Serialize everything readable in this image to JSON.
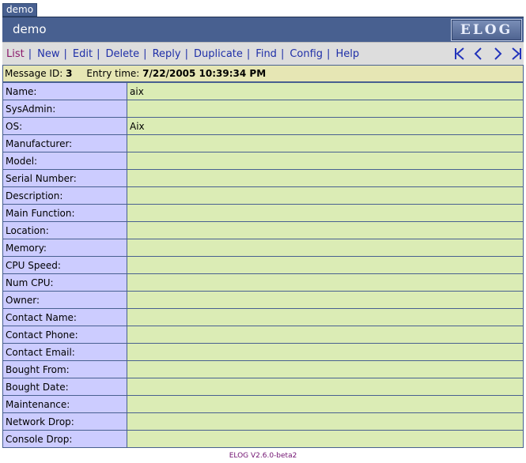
{
  "tab": {
    "label": "demo"
  },
  "header": {
    "title": "demo",
    "logo_text": "ELOG"
  },
  "menu": {
    "items": [
      {
        "label": "List",
        "active": true
      },
      {
        "label": "New"
      },
      {
        "label": "Edit"
      },
      {
        "label": "Delete"
      },
      {
        "label": "Reply"
      },
      {
        "label": "Duplicate"
      },
      {
        "label": "Find"
      },
      {
        "label": "Config"
      },
      {
        "label": "Help"
      }
    ],
    "separator": "|",
    "nav_icons": [
      "first-icon",
      "previous-icon",
      "next-icon",
      "last-icon"
    ]
  },
  "info": {
    "message_id_label": "Message ID:",
    "message_id": "3",
    "entry_time_label": "Entry time:",
    "entry_time": "7/22/2005 10:39:34 PM"
  },
  "attributes": [
    {
      "label": "Name:",
      "value": "aix"
    },
    {
      "label": "SysAdmin:",
      "value": ""
    },
    {
      "label": "OS:",
      "value": "Aix"
    },
    {
      "label": "Manufacturer:",
      "value": ""
    },
    {
      "label": "Model:",
      "value": ""
    },
    {
      "label": "Serial Number:",
      "value": ""
    },
    {
      "label": "Description:",
      "value": ""
    },
    {
      "label": "Main Function:",
      "value": ""
    },
    {
      "label": "Location:",
      "value": ""
    },
    {
      "label": "Memory:",
      "value": ""
    },
    {
      "label": "CPU Speed:",
      "value": ""
    },
    {
      "label": "Num CPU:",
      "value": ""
    },
    {
      "label": "Owner:",
      "value": ""
    },
    {
      "label": "Contact Name:",
      "value": ""
    },
    {
      "label": "Contact Phone:",
      "value": ""
    },
    {
      "label": "Contact Email:",
      "value": ""
    },
    {
      "label": "Bought From:",
      "value": ""
    },
    {
      "label": "Bought Date:",
      "value": ""
    },
    {
      "label": "Maintenance:",
      "value": ""
    },
    {
      "label": "Network Drop:",
      "value": ""
    },
    {
      "label": "Console Drop:",
      "value": ""
    }
  ],
  "footer": {
    "text": "ELOG V2.6.0-beta2"
  },
  "colors": {
    "header_bg": "#486090",
    "label_bg": "#ccccff",
    "value_bg": "#dbecb5",
    "info_bg": "#e6e6b4",
    "menu_link": "#1f2fa8"
  }
}
